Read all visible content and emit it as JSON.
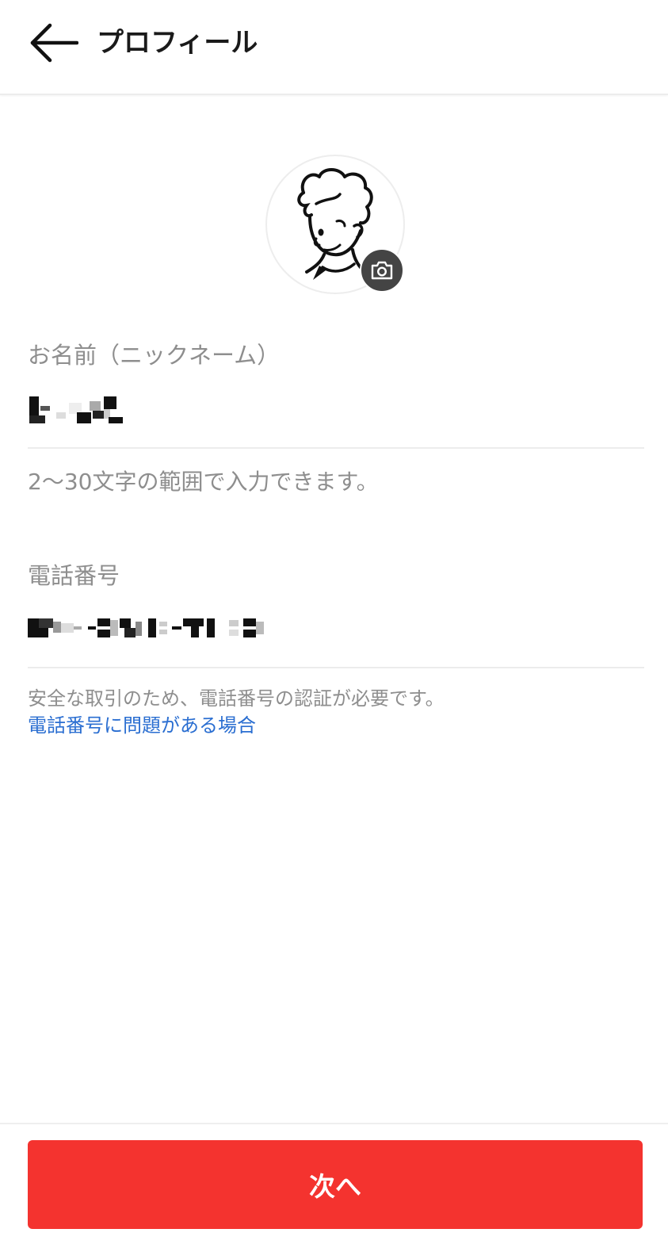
{
  "header": {
    "title": "プロフィール",
    "back_icon": "arrow-left-icon"
  },
  "avatar": {
    "image": "user-avatar-illustration",
    "camera_icon": "camera-icon"
  },
  "name_field": {
    "label": "お名前（ニックネーム）",
    "value_redacted": true,
    "help": "2〜30文字の範囲で入力できます。"
  },
  "phone_field": {
    "label": "電話番号",
    "value_redacted": true,
    "help": "安全な取引のため、電話番号の認証が必要です。",
    "link": "電話番号に問題がある場合"
  },
  "footer": {
    "next_label": "次へ"
  },
  "colors": {
    "accent": "#f4332f",
    "link": "#2a6ed1",
    "muted_text": "#8e8e8e"
  }
}
